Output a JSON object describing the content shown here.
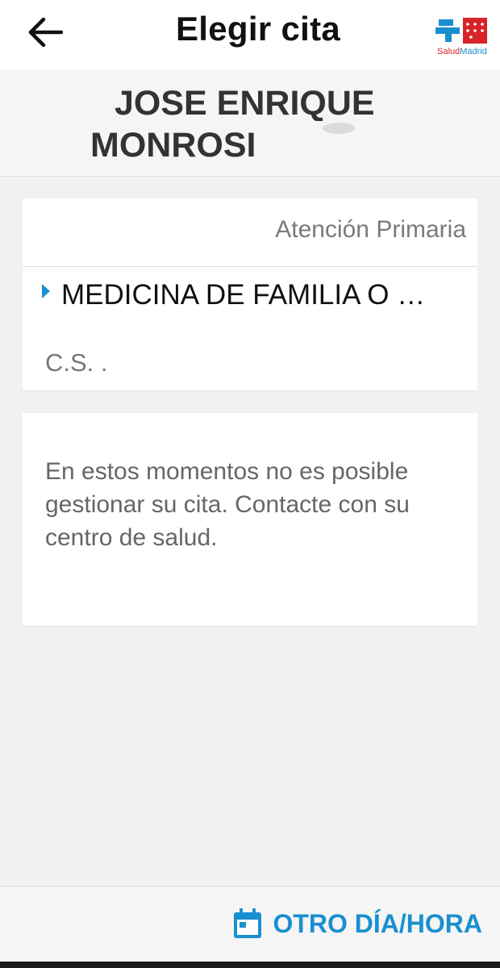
{
  "app_bar": {
    "title": "Elegir cita",
    "back_icon": "arrow-left-icon",
    "logo": {
      "text_salud": "Salud",
      "text_madrid": "Madrid",
      "colors": {
        "red": "#d8232a",
        "blue": "#1a8fd0"
      }
    }
  },
  "patient": {
    "name_line1": "JOSE ENRIQUE",
    "name_line2": "MONROSI"
  },
  "appointment": {
    "category": "Atención Primaria",
    "specialty": "MEDICINA DE FAMILIA O …",
    "center": "C.S. ."
  },
  "message": {
    "text": "En estos momentos no es posible gestionar su cita. Contacte con su centro de salud."
  },
  "bottom_bar": {
    "other_day_label": "OTRO DÍA/HORA",
    "icon": "calendar-icon"
  },
  "colors": {
    "accent": "#1a8fd0",
    "background": "#f1f1f1",
    "card": "#ffffff"
  }
}
